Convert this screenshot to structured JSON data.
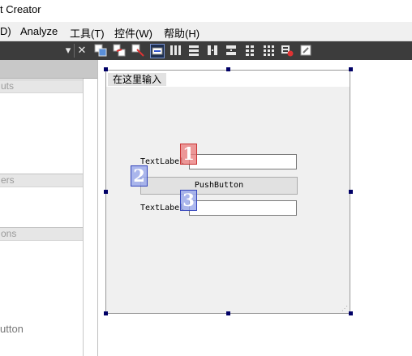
{
  "window": {
    "title": "t Creator"
  },
  "menu": [
    "D)",
    "Analyze",
    "工具(T)",
    "控件(W)",
    "帮助(H)"
  ],
  "toolbar": {
    "icons": [
      "dropdown-arrow-icon",
      "close-icon",
      "edit-widgets-icon",
      "edit-signals-slots-icon",
      "edit-buddies-icon",
      "edit-tab-order-icon",
      "layout-horizontal-icon",
      "layout-vertical-icon",
      "layout-horizontal-splitter-icon",
      "layout-vertical-splitter-icon",
      "layout-form-icon",
      "layout-grid-icon",
      "break-layout-icon",
      "adjust-size-icon"
    ]
  },
  "widget_box": {
    "categories": [
      "uts",
      "ers",
      "ons"
    ],
    "item": "utton"
  },
  "form": {
    "menu_placeholder": "在这里输入",
    "label1": "TextLabel",
    "label2": "TextLabel",
    "button": "PushButton",
    "tab_order": [
      "1",
      "2",
      "3"
    ]
  }
}
